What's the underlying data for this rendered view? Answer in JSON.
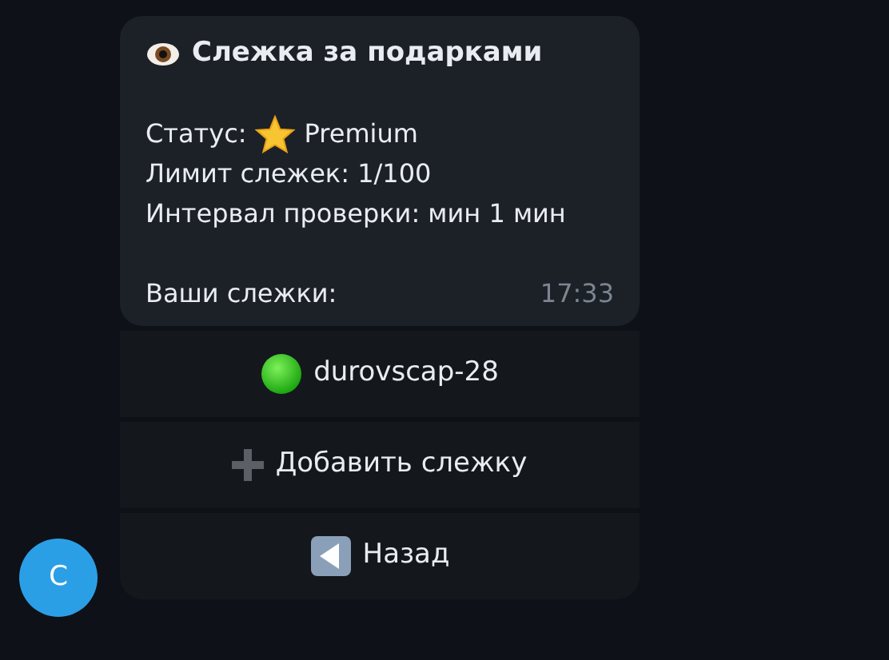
{
  "message": {
    "title": "Слежка за подарками",
    "status": {
      "label": "Статус:",
      "value": "Premium"
    },
    "lines": [
      "Лимит слежек: 1/100",
      "Интервал проверки: мин 1 мин"
    ],
    "footer": "Ваши слежки:",
    "time": "17:33"
  },
  "buttons": [
    {
      "kind": "item",
      "label": "durovscap-28"
    },
    {
      "kind": "add",
      "label": "Добавить слежку"
    },
    {
      "kind": "back",
      "label": "Назад"
    }
  ],
  "avatar": {
    "letter": "C"
  }
}
